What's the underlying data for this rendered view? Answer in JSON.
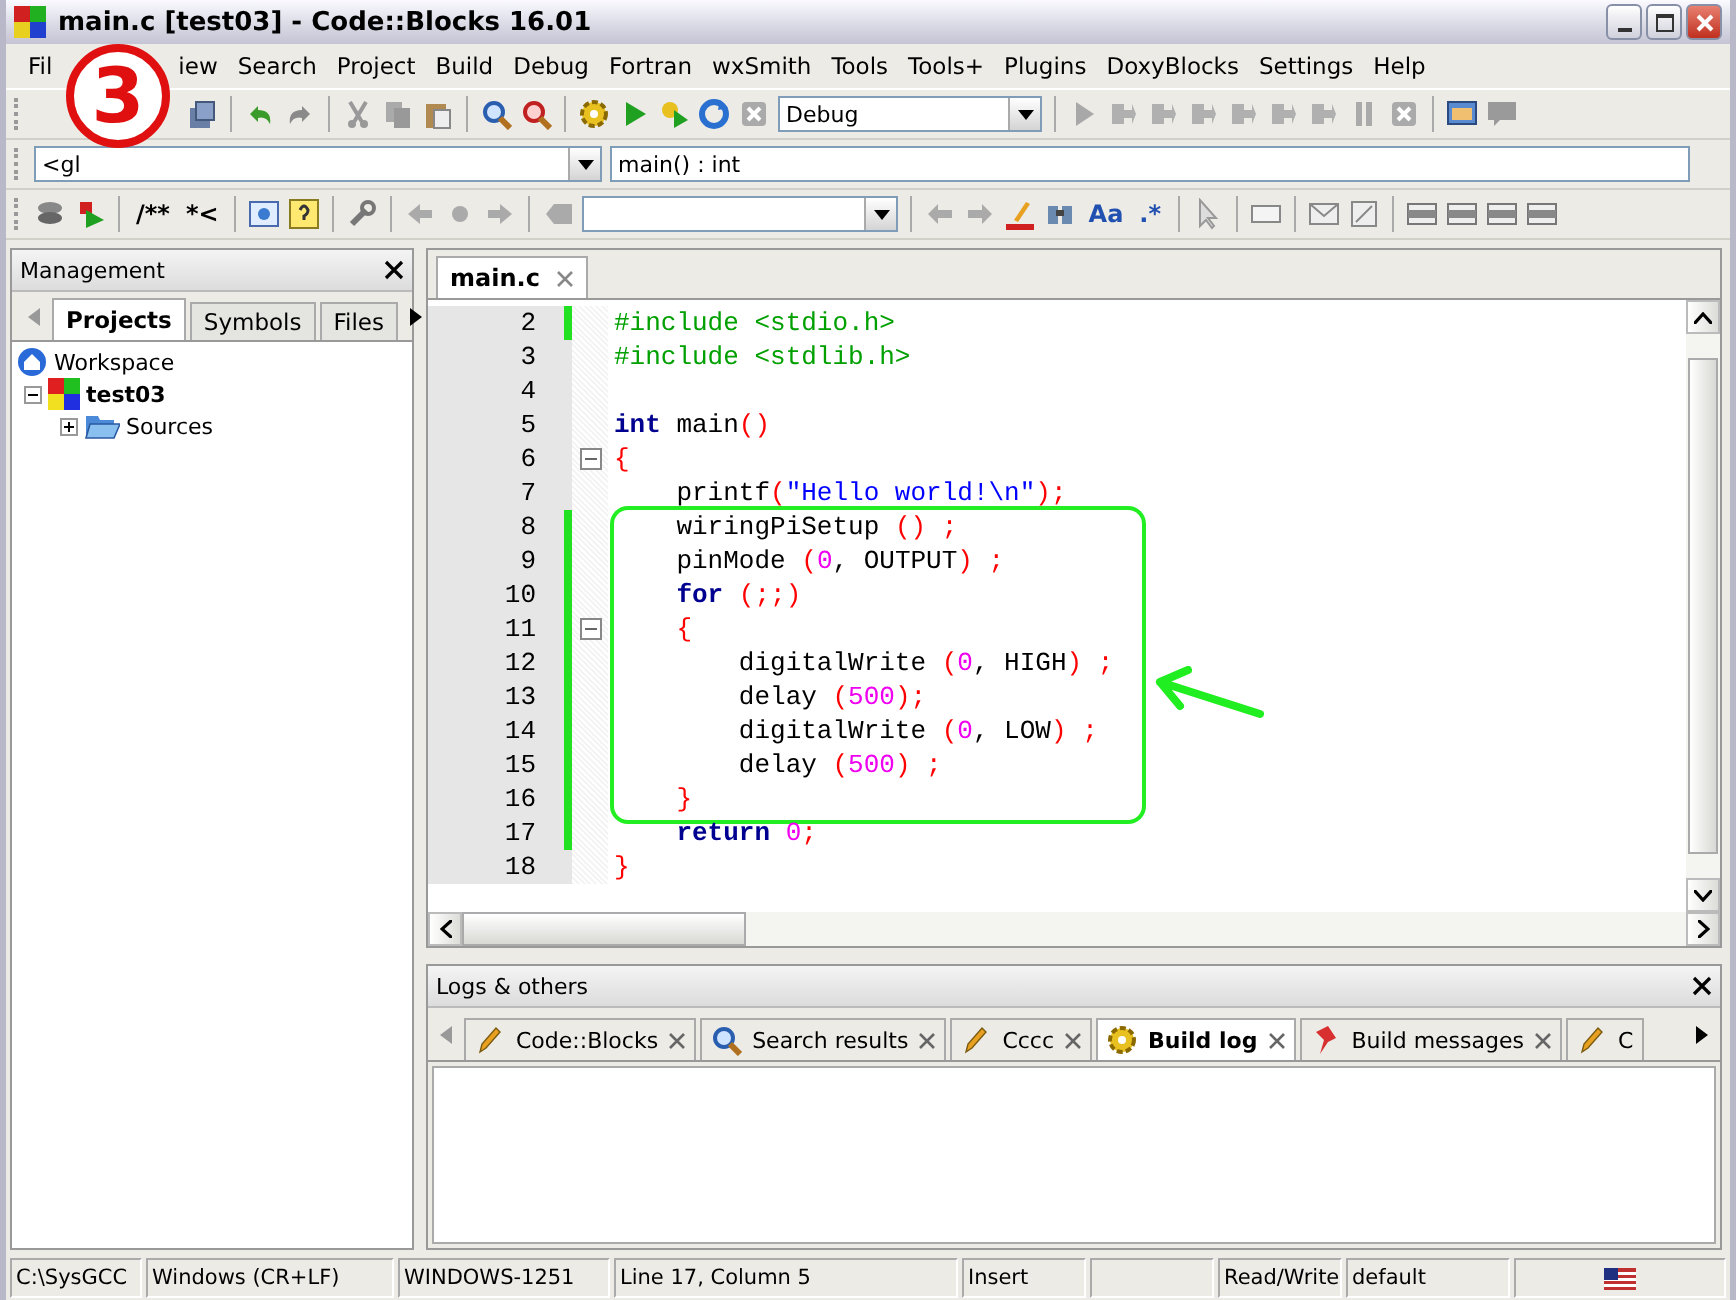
{
  "window": {
    "title": "main.c [test03] - Code::Blocks 16.01"
  },
  "annotation": {
    "label": "3"
  },
  "menu": [
    "Fil",
    "iew",
    "Search",
    "Project",
    "Build",
    "Debug",
    "Fortran",
    "wxSmith",
    "Tools",
    "Tools+",
    "Plugins",
    "DoxyBlocks",
    "Settings",
    "Help"
  ],
  "toolbar": {
    "build_target": "Debug"
  },
  "code_completion": {
    "scope": "<gl",
    "symbol": "main() : int"
  },
  "doxyblocks_toolbar": {
    "doc_comment": "/**",
    "line_comment": "*<"
  },
  "search_toolbar": {
    "match_case": "Aa",
    "regex": ".*"
  },
  "management": {
    "title": "Management",
    "tabs": [
      {
        "label": "Projects",
        "selected": true
      },
      {
        "label": "Symbols",
        "selected": false
      },
      {
        "label": "Files",
        "selected": false
      }
    ],
    "tree": [
      {
        "label": "Workspace",
        "kind": "workspace",
        "children": [
          {
            "label": "test03",
            "kind": "project",
            "expanded": true,
            "children": [
              {
                "label": "Sources",
                "kind": "folder",
                "expanded": false
              }
            ]
          }
        ]
      }
    ]
  },
  "editor": {
    "tabs": [
      {
        "label": "main.c",
        "selected": true
      }
    ],
    "lines": [
      {
        "number": "2",
        "changed": true,
        "fold": false,
        "highlighted": false,
        "tokens": [
          {
            "text": "#include <stdio.h>",
            "kind": "preprocessor"
          }
        ]
      },
      {
        "number": "3",
        "changed": false,
        "fold": false,
        "highlighted": false,
        "tokens": [
          {
            "text": "#include <stdlib.h>",
            "kind": "preprocessor"
          }
        ]
      },
      {
        "number": "4",
        "changed": false,
        "fold": false,
        "highlighted": false
      },
      {
        "number": "5",
        "changed": false,
        "fold": false,
        "highlighted": false,
        "tokens": [
          {
            "text": "int",
            "kind": "keyword"
          },
          {
            "text": " main",
            "kind": "plain"
          },
          {
            "text": "()",
            "kind": "operator"
          }
        ]
      },
      {
        "number": "6",
        "changed": false,
        "fold": true,
        "highlighted": false,
        "tokens": [
          {
            "text": "{",
            "kind": "operator"
          }
        ]
      },
      {
        "number": "7",
        "changed": false,
        "fold": false,
        "highlighted": false,
        "tokens": [
          {
            "text": "    printf",
            "kind": "plain"
          },
          {
            "text": "(",
            "kind": "operator"
          },
          {
            "text": "\"Hello world!\\n\"",
            "kind": "string"
          },
          {
            "text": ");",
            "kind": "operator"
          }
        ]
      },
      {
        "number": "8",
        "changed": true,
        "fold": false,
        "highlighted": true,
        "tokens": [
          {
            "text": "    wiringPiSetup ",
            "kind": "plain"
          },
          {
            "text": "() ;",
            "kind": "operator"
          }
        ]
      },
      {
        "number": "9",
        "changed": true,
        "fold": false,
        "highlighted": true,
        "tokens": [
          {
            "text": "    pinMode ",
            "kind": "plain"
          },
          {
            "text": "(",
            "kind": "operator"
          },
          {
            "text": "0",
            "kind": "number"
          },
          {
            "text": ", OUTPUT",
            "kind": "plain"
          },
          {
            "text": ") ;",
            "kind": "operator"
          }
        ]
      },
      {
        "number": "10",
        "changed": true,
        "fold": false,
        "highlighted": true,
        "tokens": [
          {
            "text": "    for",
            "kind": "keyword"
          },
          {
            "text": " (;;)",
            "kind": "operator"
          }
        ]
      },
      {
        "number": "11",
        "changed": true,
        "fold": true,
        "highlighted": true,
        "tokens": [
          {
            "text": "    {",
            "kind": "operator"
          }
        ]
      },
      {
        "number": "12",
        "changed": true,
        "fold": false,
        "highlighted": true,
        "tokens": [
          {
            "text": "        digitalWrite ",
            "kind": "plain"
          },
          {
            "text": "(",
            "kind": "operator"
          },
          {
            "text": "0",
            "kind": "number"
          },
          {
            "text": ", HIGH",
            "kind": "plain"
          },
          {
            "text": ") ;",
            "kind": "operator"
          }
        ]
      },
      {
        "number": "13",
        "changed": true,
        "fold": false,
        "highlighted": true,
        "tokens": [
          {
            "text": "        delay ",
            "kind": "plain"
          },
          {
            "text": "(",
            "kind": "operator"
          },
          {
            "text": "500",
            "kind": "number"
          },
          {
            "text": ");",
            "kind": "operator"
          }
        ]
      },
      {
        "number": "14",
        "changed": true,
        "fold": false,
        "highlighted": true,
        "tokens": [
          {
            "text": "        digitalWrite ",
            "kind": "plain"
          },
          {
            "text": "(",
            "kind": "operator"
          },
          {
            "text": "0",
            "kind": "number"
          },
          {
            "text": ", LOW",
            "kind": "plain"
          },
          {
            "text": ") ;",
            "kind": "operator"
          }
        ]
      },
      {
        "number": "15",
        "changed": true,
        "fold": false,
        "highlighted": true,
        "tokens": [
          {
            "text": "        delay ",
            "kind": "plain"
          },
          {
            "text": "(",
            "kind": "operator"
          },
          {
            "text": "500",
            "kind": "number"
          },
          {
            "text": ") ;",
            "kind": "operator"
          }
        ]
      },
      {
        "number": "16",
        "changed": true,
        "fold": false,
        "highlighted": true,
        "tokens": [
          {
            "text": "    }",
            "kind": "operator"
          }
        ]
      },
      {
        "number": "17",
        "changed": true,
        "fold": false,
        "highlighted": false,
        "tokens": [
          {
            "text": "    return",
            "kind": "keyword"
          },
          {
            "text": " 0",
            "kind": "number"
          },
          {
            "text": ";",
            "kind": "operator"
          }
        ]
      },
      {
        "number": "18",
        "changed": false,
        "fold": false,
        "highlighted": false,
        "tokens": [
          {
            "text": "}",
            "kind": "operator"
          }
        ]
      }
    ]
  },
  "logs": {
    "title": "Logs & others",
    "tabs": [
      {
        "label": "Code::Blocks",
        "selected": false
      },
      {
        "label": "Search results",
        "selected": false
      },
      {
        "label": "Cccc",
        "selected": false
      },
      {
        "label": "Build log",
        "selected": true
      },
      {
        "label": "Build messages",
        "selected": false
      },
      {
        "label": "C",
        "selected": false
      }
    ]
  },
  "status_bar": [
    "C:\\SysGCC",
    "Windows (CR+LF)",
    "WINDOWS-1251",
    "Line 17, Column 5",
    "Insert",
    "Read/Write",
    "default"
  ]
}
